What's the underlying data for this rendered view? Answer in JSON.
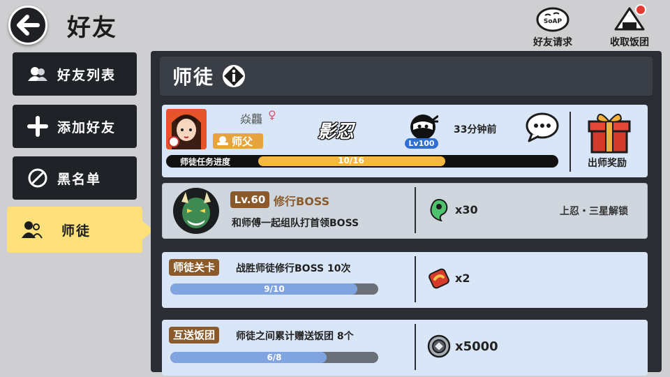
{
  "header": {
    "title": "好友",
    "actions": [
      {
        "label": "好友请求",
        "icon": "soap-bubble-icon"
      },
      {
        "label": "收取饭团",
        "icon": "rice-ball-icon"
      }
    ]
  },
  "sidebar": {
    "items": [
      {
        "label": "好友列表",
        "icon": "friends-icon",
        "active": false
      },
      {
        "label": "添加好友",
        "icon": "plus-icon",
        "active": false
      },
      {
        "label": "黑名单",
        "icon": "block-icon",
        "active": false
      },
      {
        "label": "师徒",
        "icon": "mentor-icon",
        "active": true
      }
    ]
  },
  "section": {
    "title": "师徒"
  },
  "master": {
    "name": "焱龘",
    "gender_symbol": "♀",
    "role": "师父",
    "clan_logo": "影忍",
    "level": "Lv100",
    "last_online": "33分钟前",
    "reward_label": "出师奖励",
    "progress_label": "师徒任务进度",
    "progress_text": "10/16",
    "progress_current": 10,
    "progress_total": 16
  },
  "boss": {
    "level": "Lv.60",
    "title": "修行BOSS",
    "description": "和师傅一起组队打首领BOSS",
    "reward_qty": "x30",
    "reward_icon": "green-magatama-icon",
    "unlock": "上忍・三星解锁"
  },
  "tasks": [
    {
      "tag": "师徒关卡",
      "description": "战胜师徒修行BOSS 10次",
      "progress_text": "9/10",
      "current": 9,
      "total": 10,
      "reward_qty": "x2",
      "reward_icon": "red-scroll-icon"
    },
    {
      "tag": "互送饭团",
      "description": "师徒之间累计赠送饭团 8个",
      "progress_text": "6/8",
      "current": 6,
      "total": 8,
      "reward_qty": "x5000",
      "reward_icon": "coin-icon"
    }
  ],
  "colors": {
    "accent_yellow": "#fde07a",
    "dark_panel": "#2a2d33",
    "card_blue": "#d9e6f7",
    "tag_brown": "#8a5a2b",
    "progress_orange": "#f4b843",
    "task_bar_blue": "#7fa4e0"
  }
}
